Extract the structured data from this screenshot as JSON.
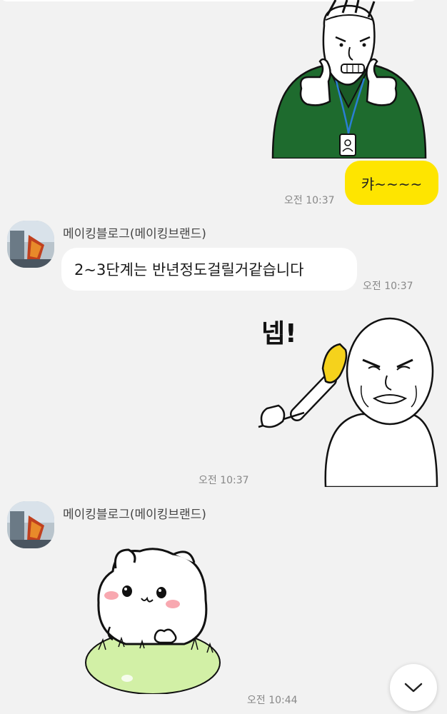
{
  "messages": {
    "m1_sticker_time": "",
    "m2_text": "캬~~~~",
    "m2_time": "오전 10:37",
    "m3_sender": "메이킹블로그(메이킹브랜드)",
    "m3_text": "2~3단계는 반년정도걸릴거같습니다",
    "m3_time": "오전 10:37",
    "m4_sticker_text": "넵!",
    "m4_time": "오전 10:37",
    "m5_sender": "메이킹블로그(메이킹브랜드)",
    "m5_time": "오전 10:44"
  },
  "icons": {
    "scroll_down": "chevron-down-icon"
  },
  "colors": {
    "background": "#f2f2f2",
    "my_bubble": "#fee500",
    "other_bubble": "#ffffff",
    "time_text": "#888888",
    "sticker_green_jacket": "#1e6b2e",
    "sticker_grass": "#cdeea0"
  }
}
